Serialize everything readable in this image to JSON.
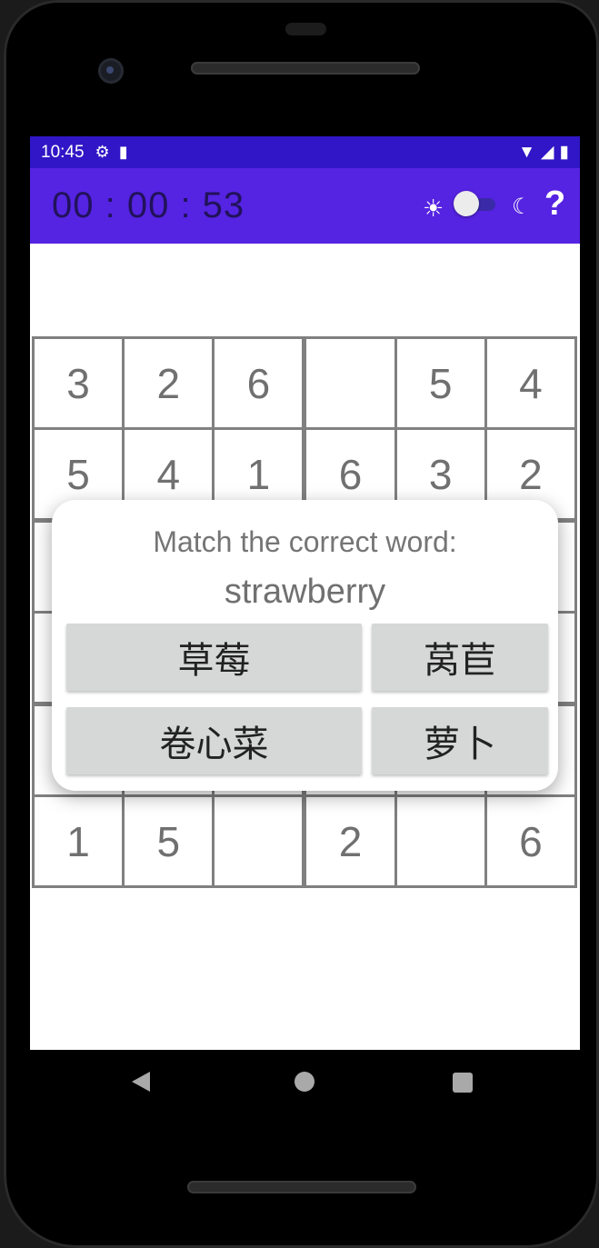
{
  "status_bar": {
    "time": "10:45",
    "settings_icon": "gear-icon",
    "sd_icon": "sd-card-icon",
    "wifi_icon": "wifi-icon",
    "signal_icon": "signal-icon",
    "battery_icon": "battery-icon"
  },
  "toolbar": {
    "timer": "00 : 00 : 53",
    "theme_toggle": {
      "sun_icon": "sun-icon",
      "moon_icon": "moon-icon",
      "state": "light"
    },
    "help_label": "?"
  },
  "grid": {
    "rows": [
      [
        "3",
        "2",
        "6",
        "",
        "5",
        "4"
      ],
      [
        "5",
        "4",
        "1",
        "6",
        "3",
        "2"
      ],
      [
        "",
        "",
        "",
        "",
        "",
        ""
      ],
      [
        "",
        "",
        "",
        "",
        "",
        ""
      ],
      [
        "",
        "",
        "",
        "",
        "",
        ""
      ],
      [
        "1",
        "5",
        "",
        "2",
        "",
        "6"
      ]
    ]
  },
  "dialog": {
    "prompt": "Match the correct word:",
    "word": "strawberry",
    "choices": [
      "草莓",
      "莴苣",
      "卷心菜",
      "萝卜"
    ]
  },
  "nav": {
    "back_icon": "back-icon",
    "home_icon": "home-icon",
    "recents_icon": "recents-icon"
  }
}
